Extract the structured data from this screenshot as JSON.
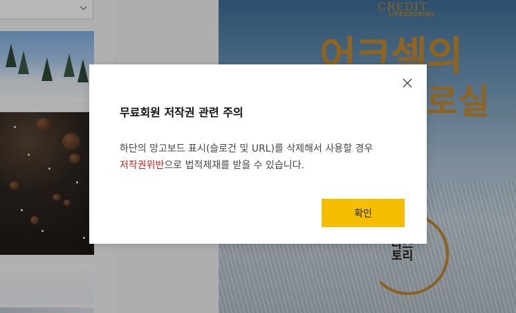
{
  "poster": {
    "logo_mark": "CREDIT",
    "brand": "LIFENOURISH",
    "headline_1": "어크셀의",
    "headline_2": "로실",
    "badge": "다스\n토리"
  },
  "modal": {
    "title": "무료회원 저작권 관련 주의",
    "body_line1": "하단의 망고보드 표시(슬로건 및 URL)를 삭제해서 사용할 경우",
    "body_highlight": "저작권위반",
    "body_line2_rest": "으로 법적제재를 받을 수 있습니다.",
    "confirm_label": "확인",
    "close_icon": "close-icon",
    "colors": {
      "confirm_bg": "#f5be00",
      "highlight": "#d01f1f"
    }
  }
}
